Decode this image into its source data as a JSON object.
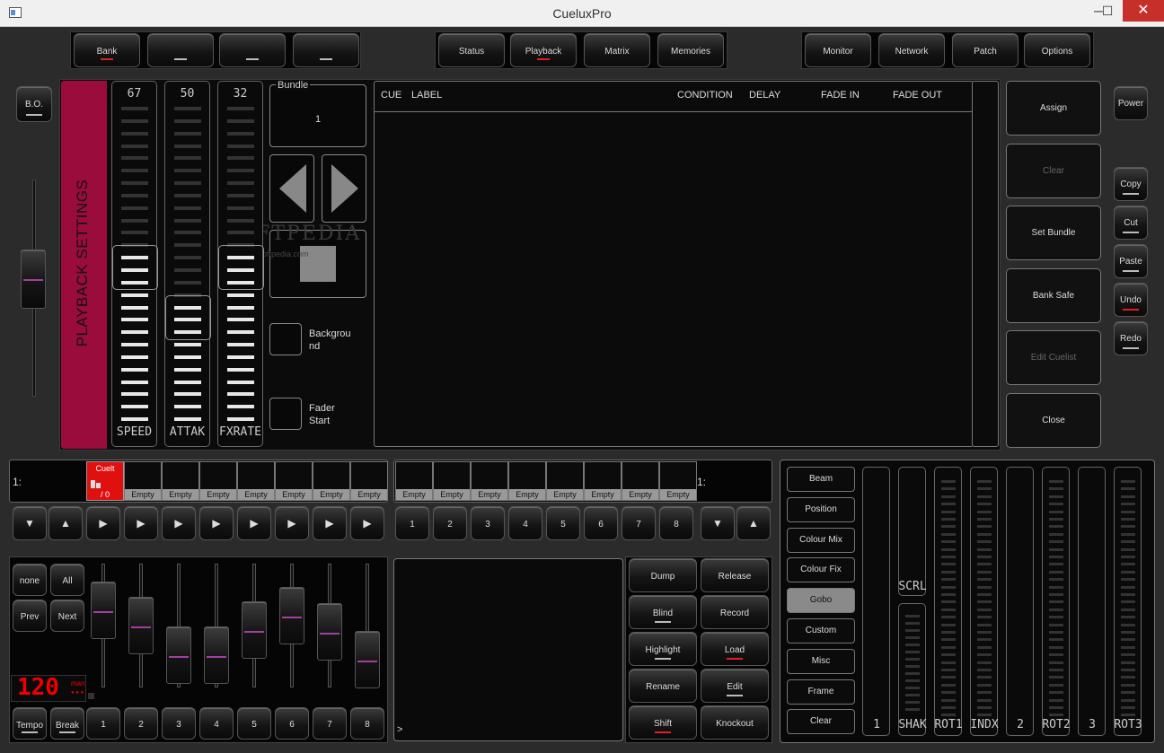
{
  "window": {
    "title": "CueluxPro",
    "minimize": "─",
    "maximize": "☐",
    "close": "✕"
  },
  "topbar": {
    "left": [
      {
        "label": "Bank",
        "ind": "red"
      },
      {
        "label": "",
        "ind": "grey"
      },
      {
        "label": "",
        "ind": "grey"
      },
      {
        "label": "",
        "ind": "grey"
      }
    ],
    "mid": [
      {
        "label": "Status",
        "ind": "none"
      },
      {
        "label": "Playback",
        "ind": "red"
      },
      {
        "label": "Matrix",
        "ind": "none"
      },
      {
        "label": "Memories",
        "ind": "none"
      }
    ],
    "right": [
      {
        "label": "Monitor",
        "ind": "none"
      },
      {
        "label": "Network",
        "ind": "none"
      },
      {
        "label": "Patch",
        "ind": "none"
      },
      {
        "label": "Options",
        "ind": "none"
      }
    ]
  },
  "left": {
    "bo_label": "B.O."
  },
  "playback_settings": {
    "title": "PLAYBACK SETTINGS",
    "faders": [
      {
        "value": "67",
        "label": "SPEED",
        "level": 0.55
      },
      {
        "value": "50",
        "label": "ATTAK",
        "level": 0.4
      },
      {
        "value": "32",
        "label": "FXRATE",
        "level": 0.55
      }
    ],
    "bundle_label": "Bundle",
    "bundle_value": "1",
    "background_label": "Backgrou nd",
    "fader_start_label": "Fader Start"
  },
  "cue_table": {
    "headers": [
      "CUE",
      "LABEL",
      "CONDITION",
      "DELAY",
      "FADE IN",
      "FADE OUT"
    ]
  },
  "watermark": {
    "name": "SOFTPEDIA",
    "url": "www.softpedia.com"
  },
  "right_actions": [
    "Assign",
    "Clear",
    "Set Bundle",
    "Bank Safe",
    "Edit Cuelist",
    "Close"
  ],
  "edit_buttons": [
    {
      "label": "Power",
      "ind": "none"
    },
    {
      "label": "Copy",
      "ind": "grey"
    },
    {
      "label": "Cut",
      "ind": "grey"
    },
    {
      "label": "Paste",
      "ind": "grey"
    },
    {
      "label": "Undo",
      "ind": "red"
    },
    {
      "label": "Redo",
      "ind": "grey"
    }
  ],
  "playback_row": {
    "left_index": "1:",
    "right_index": "1:",
    "active_cell": {
      "top": "Cuelt",
      "bottom": "/ 0"
    },
    "left_cells": [
      "Empty",
      "Empty",
      "Empty",
      "Empty",
      "Empty",
      "Empty",
      "Empty"
    ],
    "right_cells": [
      "Empty",
      "Empty",
      "Empty",
      "Empty",
      "Empty",
      "Empty",
      "Empty",
      "Empty"
    ]
  },
  "play_arrows": {
    "down": "▼",
    "up": "▲",
    "play": "▶"
  },
  "number_buttons": [
    "1",
    "2",
    "3",
    "4",
    "5",
    "6",
    "7",
    "8"
  ],
  "select_buttons": {
    "none": "none",
    "all": "All",
    "prev": "Prev",
    "next": "Next"
  },
  "tempo": {
    "bpm": "120",
    "mode": "man",
    "tempo_label": "Tempo",
    "break_label": "Break"
  },
  "lower_faders": [
    0.8,
    0.65,
    0.35,
    0.35,
    0.6,
    0.75,
    0.58,
    0.3
  ],
  "command_line": {
    "prompt": ">"
  },
  "func_buttons": [
    {
      "label": "Dump",
      "ind": "none"
    },
    {
      "label": "Release",
      "ind": "none"
    },
    {
      "label": "Blind",
      "ind": "grey"
    },
    {
      "label": "Record",
      "ind": "none"
    },
    {
      "label": "Highlight",
      "ind": "grey"
    },
    {
      "label": "Load",
      "ind": "red"
    },
    {
      "label": "Rename",
      "ind": "none"
    },
    {
      "label": "Edit",
      "ind": "grey"
    },
    {
      "label": "Shift",
      "ind": "red"
    },
    {
      "label": "Knockout",
      "ind": "none"
    }
  ],
  "attributes": {
    "groups": [
      "Beam",
      "Position",
      "Colour Mix",
      "Colour Fix",
      "Gobo",
      "Custom",
      "Misc",
      "Frame",
      "Clear"
    ],
    "selected": "Gobo",
    "columns": [
      {
        "label": "1",
        "type": "empty"
      },
      {
        "label": "SHAK",
        "type": "split",
        "top": "SCRL"
      },
      {
        "label": "ROT1",
        "type": "ticks"
      },
      {
        "label": "INDX",
        "type": "ticks"
      },
      {
        "label": "2",
        "type": "empty"
      },
      {
        "label": "ROT2",
        "type": "ticks"
      },
      {
        "label": "3",
        "type": "empty"
      },
      {
        "label": "ROT3",
        "type": "ticks"
      }
    ]
  }
}
